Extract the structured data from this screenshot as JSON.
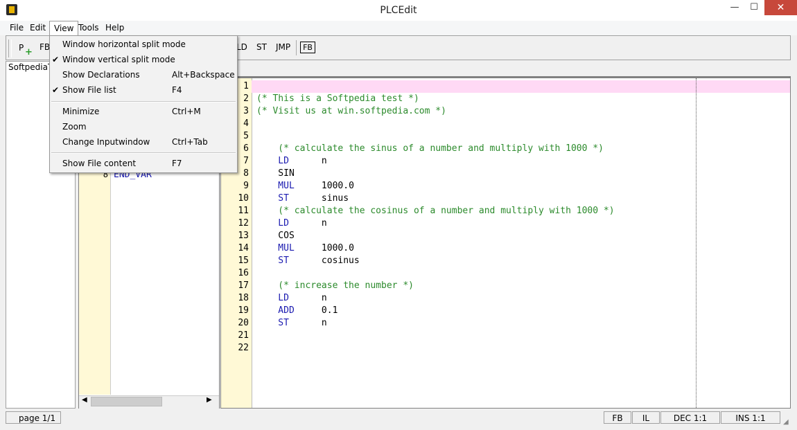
{
  "window": {
    "title": "PLCEdit",
    "minimize": "—",
    "maximize": "☐",
    "close": "✕"
  },
  "menubar": {
    "file": "File",
    "edit": "Edit",
    "view": "View",
    "tools": "Tools",
    "help": "Help"
  },
  "toolbar": {
    "p": "P",
    "fb": "FB",
    "ld": "LD",
    "st": "ST",
    "jmp": "JMP",
    "fb_box": "FB"
  },
  "filelist": {
    "item": "SoftpediaTe"
  },
  "declarations": {
    "line_num": "8",
    "code": "END_VAR"
  },
  "view_menu": {
    "items": [
      {
        "label": "Window horizontal split mode",
        "shortcut": "",
        "checked": false
      },
      {
        "label": "Window vertical split mode",
        "shortcut": "",
        "checked": true
      },
      {
        "label": "Show Declarations",
        "shortcut": "Alt+Backspace",
        "checked": false
      },
      {
        "label": "Show File list",
        "shortcut": "F4",
        "checked": true
      },
      {
        "label": "Minimize",
        "shortcut": "Ctrl+M",
        "checked": false
      },
      {
        "label": "Zoom",
        "shortcut": "",
        "checked": false
      },
      {
        "label": "Change Inputwindow",
        "shortcut": "Ctrl+Tab",
        "checked": false
      },
      {
        "label": "Show File content",
        "shortcut": "F7",
        "checked": false
      }
    ],
    "check_glyph": "✔"
  },
  "editor": {
    "lines": [
      {
        "n": "1",
        "parts": []
      },
      {
        "n": "2",
        "parts": [
          {
            "t": "(* This is a Softpedia test *)",
            "k": "comment"
          }
        ]
      },
      {
        "n": "3",
        "parts": [
          {
            "t": "(* Visit us at win.softpedia.com *)",
            "k": "comment"
          }
        ]
      },
      {
        "n": "4",
        "parts": []
      },
      {
        "n": "5",
        "parts": []
      },
      {
        "n": "6",
        "parts": [
          {
            "t": "    (* calculate the sinus of a number and multiply with 1000 *)",
            "k": "comment"
          }
        ]
      },
      {
        "n": "7",
        "parts": [
          {
            "t": "    LD",
            "k": "kw"
          },
          {
            "t": "      n",
            "k": "plain"
          }
        ]
      },
      {
        "n": "8",
        "parts": [
          {
            "t": "    SIN",
            "k": "plain"
          }
        ]
      },
      {
        "n": "9",
        "parts": [
          {
            "t": "    MUL",
            "k": "kw"
          },
          {
            "t": "     1000.0",
            "k": "plain"
          }
        ]
      },
      {
        "n": "10",
        "parts": [
          {
            "t": "    ST",
            "k": "kw"
          },
          {
            "t": "      sinus",
            "k": "plain"
          }
        ]
      },
      {
        "n": "11",
        "parts": [
          {
            "t": "    (* calculate the cosinus of a number and multiply with 1000 *)",
            "k": "comment"
          }
        ]
      },
      {
        "n": "12",
        "parts": [
          {
            "t": "    LD",
            "k": "kw"
          },
          {
            "t": "      n",
            "k": "plain"
          }
        ]
      },
      {
        "n": "13",
        "parts": [
          {
            "t": "    COS",
            "k": "plain"
          }
        ]
      },
      {
        "n": "14",
        "parts": [
          {
            "t": "    MUL",
            "k": "kw"
          },
          {
            "t": "     1000.0",
            "k": "plain"
          }
        ]
      },
      {
        "n": "15",
        "parts": [
          {
            "t": "    ST",
            "k": "kw"
          },
          {
            "t": "      cosinus",
            "k": "plain"
          }
        ]
      },
      {
        "n": "16",
        "parts": []
      },
      {
        "n": "17",
        "parts": [
          {
            "t": "    (* increase the number *)",
            "k": "comment"
          }
        ]
      },
      {
        "n": "18",
        "parts": [
          {
            "t": "    LD",
            "k": "kw"
          },
          {
            "t": "      n",
            "k": "plain"
          }
        ]
      },
      {
        "n": "19",
        "parts": [
          {
            "t": "    ADD",
            "k": "kw"
          },
          {
            "t": "     0.1",
            "k": "plain"
          }
        ]
      },
      {
        "n": "20",
        "parts": [
          {
            "t": "    ST",
            "k": "kw"
          },
          {
            "t": "      n",
            "k": "plain"
          }
        ]
      },
      {
        "n": "21",
        "parts": []
      },
      {
        "n": "22",
        "parts": []
      }
    ]
  },
  "statusbar": {
    "page": "page 1/1",
    "mode": "FB",
    "lang": "IL",
    "dec": "DEC 1:1",
    "ins": "INS 1:1"
  },
  "colors": {
    "comment": "#2b8a2b",
    "keyword": "#1a1ab0",
    "gutter": "#fff9d6",
    "current_line": "#ffd9f5"
  }
}
